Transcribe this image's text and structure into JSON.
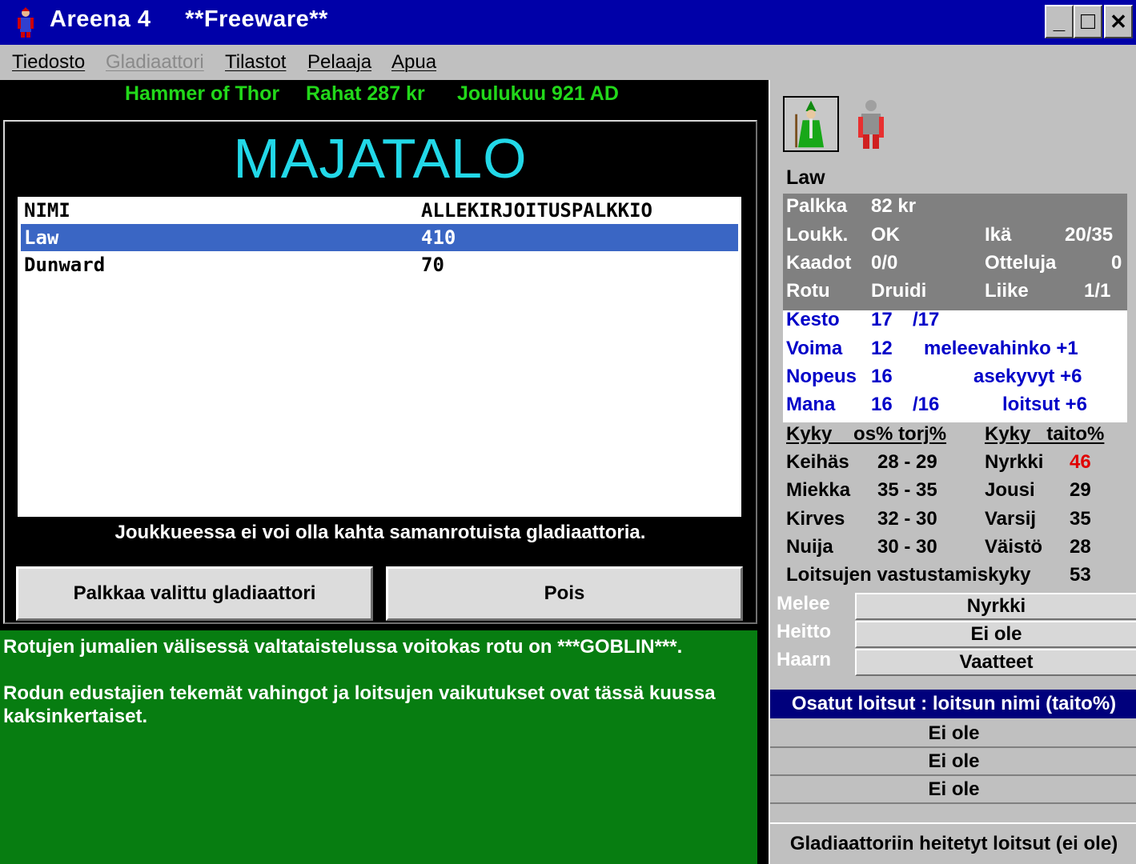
{
  "window": {
    "title": "Areena 4     **Freeware**",
    "minimize": "_",
    "maximize": "□",
    "close": "✕"
  },
  "menu": [
    {
      "label": "Tiedosto",
      "enabled": true
    },
    {
      "label": "Gladiaattori",
      "enabled": false
    },
    {
      "label": "Tilastot",
      "enabled": true
    },
    {
      "label": "Pelaaja",
      "enabled": true
    },
    {
      "label": "Apua",
      "enabled": true
    }
  ],
  "status": {
    "team": "Hammer of Thor",
    "money": "Rahat 287 kr",
    "date": "Joulukuu 921 AD"
  },
  "dialog": {
    "title": "MAJATALO",
    "columns": {
      "name": "NIMI",
      "fee": "ALLEKIRJOITUSPALKKIO"
    },
    "rows": [
      {
        "name": "Law",
        "fee": "410",
        "selected": true
      },
      {
        "name": "Dunward",
        "fee": "70",
        "selected": false
      }
    ],
    "note": "Joukkueessa ei voi olla kahta samanrotuista gladiaattoria.",
    "hire_button": "Palkkaa valittu gladiaattori",
    "exit_button": "Pois"
  },
  "news": {
    "line1": "Rotujen jumalien välisessä valtataistelussa voitokas rotu on ***GOBLIN***.",
    "line2": "Rodun edustajien tekemät vahingot ja loitsujen vaikutukset ovat tässä kuussa kaksinkertaiset."
  },
  "gladiator": {
    "name": "Law",
    "palkka_label": "Palkka",
    "palkka": "82 kr",
    "loukk_label": "Loukk.",
    "loukk": "OK",
    "ika_label": "Ikä",
    "ika": "20/35",
    "kaadot_label": "Kaadot",
    "kaadot": "0/0",
    "otteluja_label": "Otteluja",
    "otteluja": "0",
    "rotu_label": "Rotu",
    "rotu": "Druidi",
    "liike_label": "Liike",
    "liike": "1/1",
    "kesto_label": "Kesto",
    "kesto": "17",
    "kesto_max": "/17",
    "voima_label": "Voima",
    "voima": "12",
    "melee_bonus": "meleevahinko +1",
    "nopeus_label": "Nopeus",
    "nopeus": "16",
    "weapon_skill": "asekyvyt +6",
    "mana_label": "Mana",
    "mana": "16",
    "mana_max": "/16",
    "spell_bonus": "loitsut +6",
    "skills_header_left": "Kyky    os% torj%",
    "skills_header_right": "Kyky   taito%",
    "skills_left": [
      {
        "name": "Keihäs",
        "value": "28 - 29"
      },
      {
        "name": "Miekka",
        "value": "35 - 35"
      },
      {
        "name": "Kirves",
        "value": "32 - 30"
      },
      {
        "name": "Nuija",
        "value": "30 - 30"
      }
    ],
    "skills_right": [
      {
        "name": "Nyrkki",
        "value": "46"
      },
      {
        "name": "Jousi",
        "value": "29"
      },
      {
        "name": "Varsij",
        "value": "35"
      },
      {
        "name": "Väistö",
        "value": "28"
      }
    ],
    "resist_label": "Loitsujen vastustamiskyky",
    "resist": "53",
    "equipment": [
      {
        "label": "Melee",
        "value": "Nyrkki"
      },
      {
        "label": "Heitto",
        "value": "Ei ole"
      },
      {
        "label": "Haarn",
        "value": "Vaatteet"
      }
    ],
    "spells_header": "Osatut loitsut : loitsun nimi (taito%)",
    "spells": [
      "Ei ole",
      "Ei ole",
      "Ei ole"
    ],
    "cast_spells": "Gladiaattoriin heitetyt loitsut (ei ole)"
  },
  "colors": {
    "titlebar": "#0000a8",
    "status_text": "#22d81a",
    "dialog_title": "#22d8e8",
    "selection": "#3a66c4",
    "news_bg": "#077d11",
    "stat_blue": "#0000c8",
    "highlight_red": "#e00000"
  }
}
